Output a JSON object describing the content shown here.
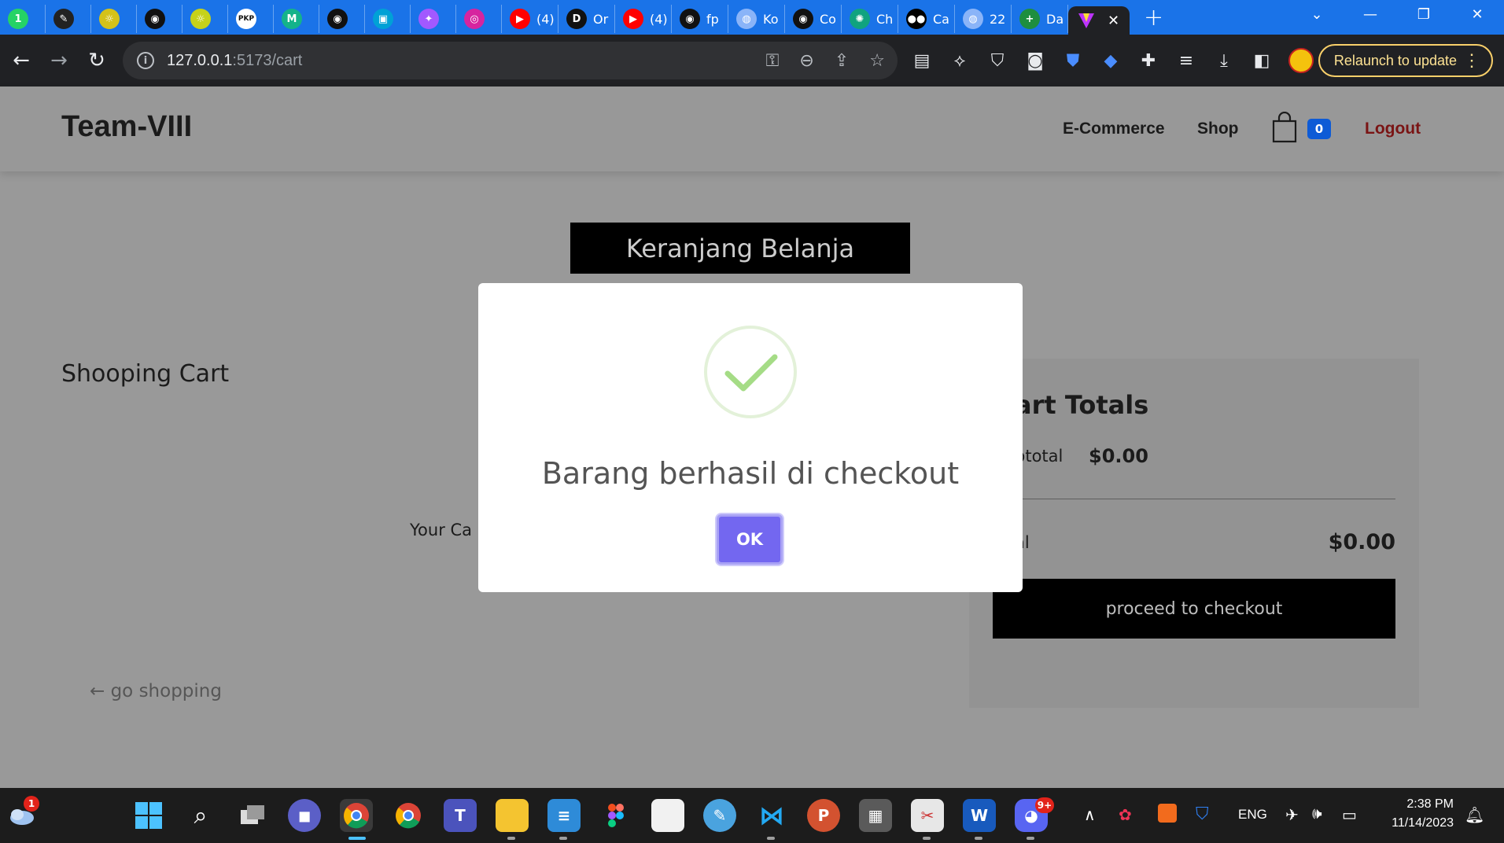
{
  "browser": {
    "tabs": [
      {
        "title": "",
        "favicon": "whatsapp-icon",
        "color": "#25d366",
        "glyph": "1"
      },
      {
        "title": "",
        "favicon": "rocket-icon",
        "color": "#222222",
        "glyph": "✎"
      },
      {
        "title": "",
        "favicon": "university-logo-icon",
        "color": "#d4c21a",
        "glyph": "☼"
      },
      {
        "title": "",
        "favicon": "github-icon",
        "color": "#111111",
        "glyph": "◉"
      },
      {
        "title": "",
        "favicon": "university-logo-icon",
        "color": "#c6d21a",
        "glyph": "☼"
      },
      {
        "title": "",
        "favicon": "pkp-icon",
        "color": "#ffffff",
        "glyph": "PKP"
      },
      {
        "title": "",
        "favicon": "mysoft-icon",
        "color": "#14b38a",
        "glyph": "M"
      },
      {
        "title": "",
        "favicon": "github-icon",
        "color": "#111111",
        "glyph": "◉"
      },
      {
        "title": "",
        "favicon": "bilibili-icon",
        "color": "#00a1d6",
        "glyph": "▣"
      },
      {
        "title": "",
        "favicon": "figma-icon",
        "color": "#a259ff",
        "glyph": "✦"
      },
      {
        "title": "",
        "favicon": "instagram-icon",
        "color": "#d6249f",
        "glyph": "◎"
      },
      {
        "title": "(4)",
        "favicon": "youtube-icon",
        "color": "#ff0000",
        "glyph": "▶"
      },
      {
        "title": "Or",
        "favicon": "d-logo-icon",
        "color": "#111111",
        "glyph": "D"
      },
      {
        "title": "(4)",
        "favicon": "youtube-icon",
        "color": "#ff0000",
        "glyph": "▶"
      },
      {
        "title": "fp",
        "favicon": "github-icon",
        "color": "#111111",
        "glyph": "◉"
      },
      {
        "title": "Ko",
        "favicon": "globe-icon",
        "color": "#8ab4f8",
        "glyph": "◍"
      },
      {
        "title": "Co",
        "favicon": "github-icon",
        "color": "#111111",
        "glyph": "◉"
      },
      {
        "title": "Ch",
        "favicon": "chatgpt-icon",
        "color": "#10a37f",
        "glyph": "✺"
      },
      {
        "title": "Ca",
        "favicon": "medium-icon",
        "color": "#000000",
        "glyph": "●●"
      },
      {
        "title": "22",
        "favicon": "globe-icon",
        "color": "#8ab4f8",
        "glyph": "◍"
      },
      {
        "title": "Da",
        "favicon": "plus-sheet-icon",
        "color": "#1e8e3e",
        "glyph": "+"
      }
    ],
    "active_tab_favicon": "vite-icon",
    "url_host": "127.0.0.1",
    "url_path": ":5173/cart",
    "relaunch_label": "Relaunch to update"
  },
  "site": {
    "brand": "Team-VIII",
    "nav": {
      "ecommerce": "E-Commerce",
      "shop": "Shop",
      "cart_count": "0",
      "logout": "Logout"
    },
    "page_heading": "Keranjang Belanja",
    "section_title": "Shooping Cart",
    "empty_message": "Your Ca",
    "totals": {
      "title": "art Totals",
      "subtotal_label": "btotal",
      "subtotal_value": "$0.00",
      "total_label": "al",
      "total_value": "$0.00",
      "checkout_label": "proceed to checkout"
    },
    "go_shopping": "← go shopping"
  },
  "modal": {
    "title": "Barang berhasil di checkout",
    "ok_label": "OK",
    "success_color": "#a5dc86"
  },
  "taskbar": {
    "time": "2:38 PM",
    "date": "11/14/2023",
    "language": "ENG",
    "weather_badge": "1",
    "discord_badge": "9+"
  }
}
